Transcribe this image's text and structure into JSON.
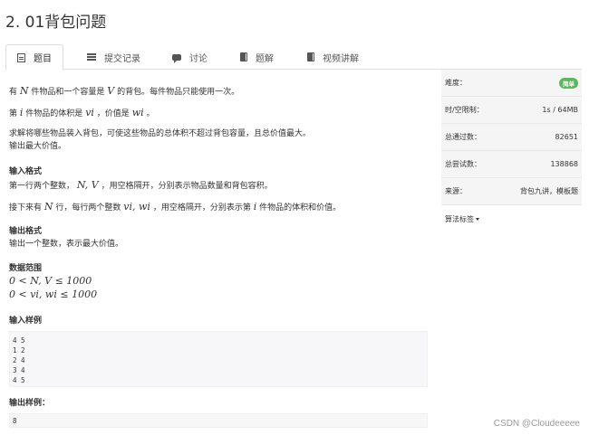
{
  "title": "2. 01背包问题",
  "tabs": [
    {
      "label": "题目",
      "icon": "document-icon"
    },
    {
      "label": "提交记录",
      "icon": "list-icon"
    },
    {
      "label": "讨论",
      "icon": "comment-icon"
    },
    {
      "label": "题解",
      "icon": "book-icon"
    },
    {
      "label": "视频讲解",
      "icon": "book-icon"
    }
  ],
  "problem": {
    "p1_a": "有",
    "p1_m1": "N",
    "p1_b": "件物品和一个容量是",
    "p1_m2": "V",
    "p1_c": "的背包。每件物品只能使用一次。",
    "p2_a": "第",
    "p2_m1": "i",
    "p2_b": "件物品的体积是",
    "p2_m2": "vi",
    "p2_c": "，价值是",
    "p2_m3": "wi",
    "p2_d": "。",
    "p3": "求解将哪些物品装入背包，可使这些物品的总体积不超过背包容量，且总价值最大。",
    "p4": "输出最大价值。",
    "input_format_title": "输入格式",
    "if1_a": "第一行两个整数，",
    "if1_m": "N, V",
    "if1_b": "，用空格隔开，分别表示物品数量和背包容积。",
    "if2_a": "接下来有",
    "if2_m1": "N",
    "if2_b": "行，每行两个整数",
    "if2_m2": "vi, wi",
    "if2_c": "，用空格隔开，分别表示第",
    "if2_m3": "i",
    "if2_d": "件物品的体积和价值。",
    "output_format_title": "输出格式",
    "of1": "输出一个整数，表示最大价值。",
    "range_title": "数据范围",
    "range1": "0 < N, V ≤ 1000",
    "range2": "0 < vi, wi ≤ 1000",
    "sample_input_title": "输入样例",
    "sample_input": [
      "4 5",
      "1 2",
      "2 4",
      "3 4",
      "4 5"
    ],
    "sample_output_title": "输出样例：",
    "sample_output": "8"
  },
  "info": {
    "difficulty_label": "难度：",
    "difficulty_value": "简单",
    "limit_label": "时/空限制：",
    "limit_value": "1s / 64MB",
    "passed_label": "总通过数：",
    "passed_value": "82651",
    "attempts_label": "总尝试数：",
    "attempts_value": "138868",
    "source_label": "来源：",
    "source_value": "背包九讲，模板题",
    "tags_label": "算法标签"
  },
  "colors": {
    "badge": "#5cb85c",
    "border": "#dddddd",
    "panel": "#f5f5f5"
  },
  "watermark": "CSDN @Cloudeeeee"
}
